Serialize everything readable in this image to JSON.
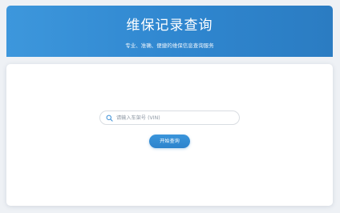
{
  "header": {
    "title": "维保记录查询",
    "subtitle": "专业、准确、便捷的维保信息查询服务"
  },
  "search": {
    "placeholder": "请输入车架号 (VIN)",
    "value": "",
    "icon": "search-icon"
  },
  "actions": {
    "submit_label": "开始查询"
  },
  "colors": {
    "header_start": "#3d97dc",
    "header_end": "#2b7cc2",
    "background": "#eef1f5",
    "button": "#2f86cf"
  }
}
